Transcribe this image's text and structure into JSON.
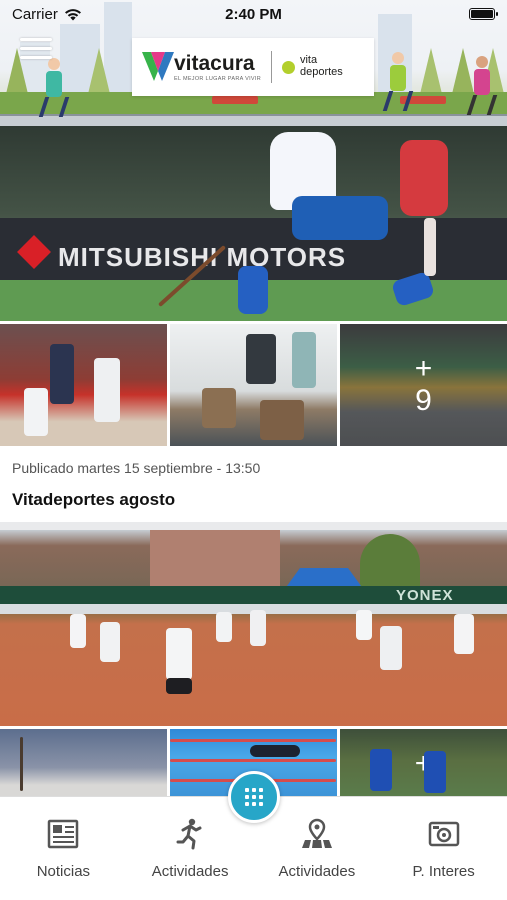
{
  "status_bar": {
    "carrier": "Carrier",
    "time": "2:40 PM"
  },
  "header": {
    "logo": {
      "brand": "vitacura",
      "tagline": "EL MEJOR LUGAR PARA VIVIR",
      "partner_line1": "vita",
      "partner_line2": "deportes"
    },
    "colors": {
      "brand_v_green": "#37b34a",
      "brand_v_pink": "#e2257b",
      "brand_v_blue": "#2f79c0",
      "partner_dot": "#b3cf2c"
    }
  },
  "posts": [
    {
      "hero_banner_text": "MITSUBISHI MOTORS",
      "more_photos": {
        "plus": "+",
        "count": "9"
      },
      "date": "Publicado martes 15 septiembre - 13:50",
      "title": "Vitadeportes agosto"
    },
    {
      "hero_banner_text": "YONEX",
      "more_photos": {
        "plus": "+",
        "count": ""
      }
    }
  ],
  "tabbar": {
    "accent": "#27a6c8",
    "center_button_icon": "grid-icon",
    "items": [
      {
        "label": "Noticias",
        "icon": "newspaper-icon"
      },
      {
        "label": "Actividades",
        "icon": "running-person-icon"
      },
      {
        "label": "Actividades",
        "icon": "map-pin-icon"
      },
      {
        "label": "P. Interes",
        "icon": "camera-icon"
      }
    ]
  }
}
